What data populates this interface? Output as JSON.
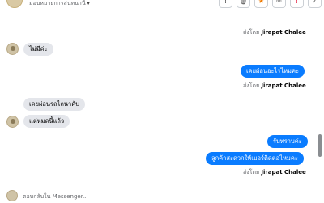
{
  "header": {
    "page_label": "มอบหมายการสนทนานี้",
    "caret": "▾",
    "actions": [
      {
        "name": "info",
        "glyph": "!"
      },
      {
        "name": "trash",
        "glyph": "🗑"
      },
      {
        "name": "star",
        "glyph": "★"
      },
      {
        "name": "mail",
        "glyph": "✉"
      },
      {
        "name": "flag",
        "glyph": "!"
      },
      {
        "name": "check",
        "glyph": "✓"
      }
    ]
  },
  "sent_by_prefix": "ส่งโดย",
  "sent_by_name": "Jirapat Chalee",
  "messages": [
    {
      "text": "ไม่มีค่ะ",
      "dir": "in"
    },
    {
      "text": "เคยผ่อนอะไรไหมคะ",
      "dir": "out"
    },
    {
      "text": "เคยผ่อนรถไถนาค้บ",
      "dir": "in"
    },
    {
      "text": "แต่หมดนี้แล้ว",
      "dir": "in"
    },
    {
      "text": "รับทราบค่ะ",
      "dir": "out"
    },
    {
      "text": "ลูกค้าสะดวกให้เบอร์ติดต่อไหมคะ",
      "dir": "out"
    }
  ],
  "composer": {
    "placeholder": "ตอบกลับใน Messenger..."
  },
  "colors": {
    "outgoing_bubble": "#0a7cff",
    "incoming_bubble": "#e4e6eb"
  }
}
